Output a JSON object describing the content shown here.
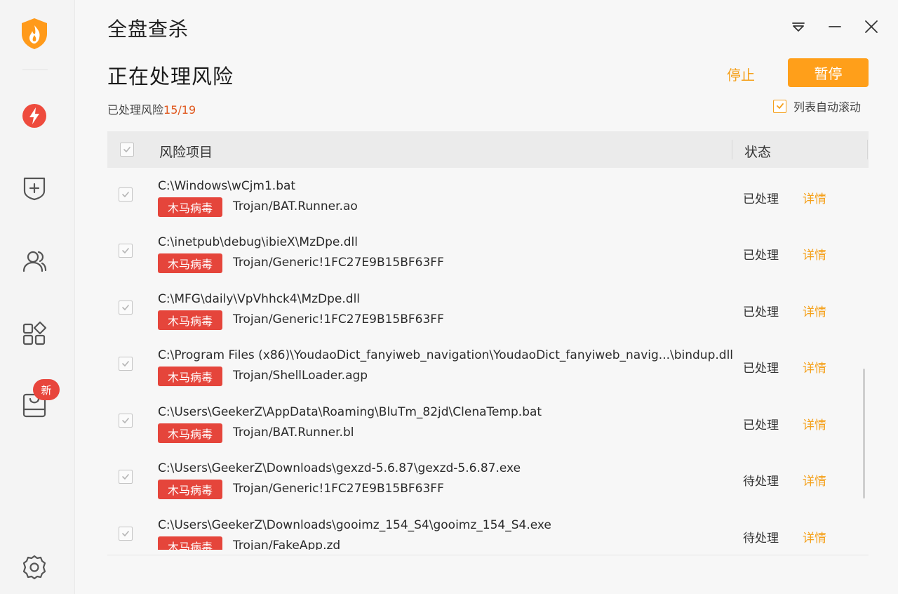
{
  "window": {
    "title": "全盘查杀"
  },
  "sidebar": {
    "logo": "shield-flame-logo",
    "items": [
      {
        "icon": "lightning-icon",
        "name": "speedup"
      },
      {
        "icon": "shield-plus-icon",
        "name": "protection"
      },
      {
        "icon": "users-icon",
        "name": "accounts"
      },
      {
        "icon": "apps-grid-icon",
        "name": "toolbox"
      },
      {
        "icon": "bag-icon",
        "name": "store",
        "badge": "新"
      }
    ],
    "settings_icon": "gear-icon"
  },
  "header": {
    "heading": "正在处理风险",
    "progress_label": "已处理风险",
    "progress_count": "15/19",
    "stop_label": "停止",
    "pause_label": "暂停",
    "autoscroll_label": "列表自动滚动"
  },
  "table": {
    "columns": [
      "风险项目",
      "状态"
    ],
    "rows": [
      {
        "path": "C:\\Windows\\wCjm1.bat",
        "tag": "木马病毒",
        "threat": "Trojan/BAT.Runner.ao",
        "status": "已处理",
        "detail": "详情"
      },
      {
        "path": "C:\\inetpub\\debug\\ibieX\\MzDpe.dll",
        "tag": "木马病毒",
        "threat": "Trojan/Generic!1FC27E9B15BF63FF",
        "status": "已处理",
        "detail": "详情"
      },
      {
        "path": "C:\\MFG\\daily\\VpVhhck4\\MzDpe.dll",
        "tag": "木马病毒",
        "threat": "Trojan/Generic!1FC27E9B15BF63FF",
        "status": "已处理",
        "detail": "详情"
      },
      {
        "path": "C:\\Program Files (x86)\\YoudaoDict_fanyiweb_navigation\\YoudaoDict_fanyiweb_navig...\\bindup.dll",
        "tag": "木马病毒",
        "threat": "Trojan/ShellLoader.agp",
        "status": "已处理",
        "detail": "详情"
      },
      {
        "path": "C:\\Users\\GeekerZ\\AppData\\Roaming\\BluTm_82jd\\ClenaTemp.bat",
        "tag": "木马病毒",
        "threat": "Trojan/BAT.Runner.bl",
        "status": "已处理",
        "detail": "详情"
      },
      {
        "path": "C:\\Users\\GeekerZ\\Downloads\\gexzd-5.6.87\\gexzd-5.6.87.exe",
        "tag": "木马病毒",
        "threat": "Trojan/Generic!1FC27E9B15BF63FF",
        "status": "待处理",
        "detail": "详情"
      },
      {
        "path": "C:\\Users\\GeekerZ\\Downloads\\gooimz_154_S4\\gooimz_154_S4.exe",
        "tag": "木马病毒",
        "threat": "Trojan/FakeApp.zd",
        "status": "待处理",
        "detail": "详情"
      }
    ]
  },
  "colors": {
    "accent": "#ff9f1a",
    "danger": "#e5453b",
    "count": "#e0581e"
  }
}
